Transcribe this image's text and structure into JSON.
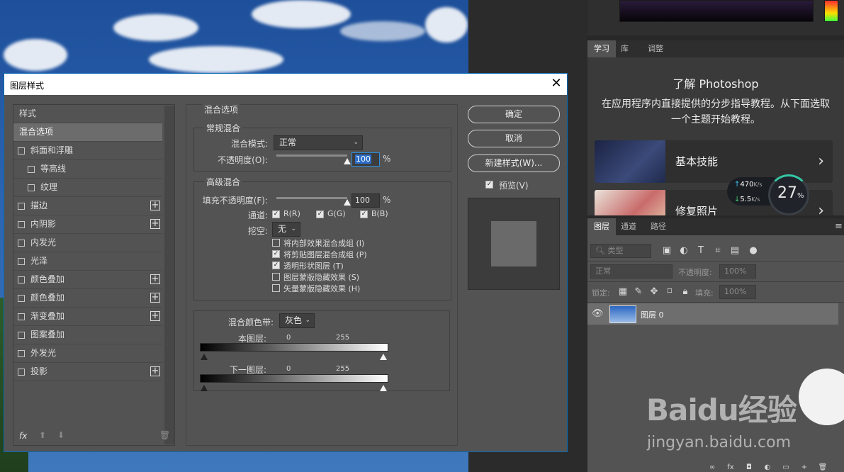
{
  "dialog": {
    "title": "图层样式",
    "close_glyph": "✕",
    "style_list": [
      {
        "label": "样式",
        "checkbox": false,
        "plus": false,
        "indent": 0,
        "selected": false
      },
      {
        "label": "混合选项",
        "checkbox": false,
        "plus": false,
        "indent": 0,
        "selected": true
      },
      {
        "label": "斜面和浮雕",
        "checkbox": true,
        "plus": false,
        "indent": 0,
        "selected": false
      },
      {
        "label": "等高线",
        "checkbox": true,
        "plus": false,
        "indent": 1,
        "selected": false
      },
      {
        "label": "纹理",
        "checkbox": true,
        "plus": false,
        "indent": 1,
        "selected": false
      },
      {
        "label": "描边",
        "checkbox": true,
        "plus": true,
        "indent": 0,
        "selected": false
      },
      {
        "label": "内阴影",
        "checkbox": true,
        "plus": true,
        "indent": 0,
        "selected": false
      },
      {
        "label": "内发光",
        "checkbox": true,
        "plus": false,
        "indent": 0,
        "selected": false
      },
      {
        "label": "光泽",
        "checkbox": true,
        "plus": false,
        "indent": 0,
        "selected": false
      },
      {
        "label": "颜色叠加",
        "checkbox": true,
        "plus": true,
        "indent": 0,
        "selected": false
      },
      {
        "label": "颜色叠加",
        "checkbox": true,
        "plus": true,
        "indent": 0,
        "selected": false
      },
      {
        "label": "渐变叠加",
        "checkbox": true,
        "plus": true,
        "indent": 0,
        "selected": false
      },
      {
        "label": "图案叠加",
        "checkbox": true,
        "plus": false,
        "indent": 0,
        "selected": false
      },
      {
        "label": "外发光",
        "checkbox": true,
        "plus": false,
        "indent": 0,
        "selected": false
      },
      {
        "label": "投影",
        "checkbox": true,
        "plus": true,
        "indent": 0,
        "selected": false
      }
    ],
    "footer_icons": [
      "fx-icon",
      "move-up-icon",
      "move-down-icon",
      "trash-icon"
    ],
    "footer_fx_label": "fx",
    "blend": {
      "section_title": "混合选项",
      "normal_group_title": "常规混合",
      "mode_label": "混合模式:",
      "mode_value": "正常",
      "opacity_label": "不透明度(O):",
      "opacity_value": "100",
      "opacity_percent": 100,
      "percent_sign": "%",
      "advanced_group_title": "高级混合",
      "fill_label": "填充不透明度(F):",
      "fill_value": "100",
      "fill_percent": 100,
      "channels_label": "通道:",
      "channels": [
        {
          "label": "R(R)",
          "checked": true
        },
        {
          "label": "G(G)",
          "checked": true
        },
        {
          "label": "B(B)",
          "checked": true
        }
      ],
      "knockout_label": "挖空:",
      "knockout_value": "无",
      "options": [
        {
          "label": "将内部效果混合成组 (I)",
          "checked": false
        },
        {
          "label": "将剪贴图层混合成组 (P)",
          "checked": true
        },
        {
          "label": "透明形状图层 (T)",
          "checked": true
        },
        {
          "label": "图层蒙版隐藏效果 (S)",
          "checked": false
        },
        {
          "label": "矢量蒙版隐藏效果 (H)",
          "checked": false
        }
      ],
      "band_label": "混合颜色带:",
      "band_value": "灰色",
      "this_layer_label": "本图层:",
      "this_layer_min": "0",
      "this_layer_max": "255",
      "below_layer_label": "下一图层:",
      "below_layer_min": "0",
      "below_layer_max": "255"
    },
    "buttons": {
      "ok": "确定",
      "cancel": "取消",
      "new_style": "新建样式(W)...",
      "preview_label": "预览(V)",
      "preview_checked": true
    }
  },
  "right_panel": {
    "learn_tabs": [
      "学习",
      "库",
      "调整"
    ],
    "learn_title": "了解 Photoshop",
    "learn_desc": "在应用程序内直接提供的分步指导教程。从下面选取一个主题开始教程。",
    "cards": [
      {
        "label": "基本技能",
        "arrow": "›"
      },
      {
        "label": "修复照片",
        "arrow": "›"
      }
    ],
    "layers_tabs": [
      "图层",
      "通道",
      "路径"
    ],
    "filter_label": "类型",
    "blend_mode": "正常",
    "opacity_label": "不透明度:",
    "opacity_value": "100%",
    "lock_label": "锁定:",
    "fill_label": "填充:",
    "fill_value": "100%",
    "layer_name": "图层 0"
  },
  "speed_widget": {
    "up": "470",
    "up_unit": "K/s",
    "down": "5.5",
    "down_unit": "K/s",
    "percent": "27",
    "percent_sign": "%"
  },
  "watermark": {
    "logo": "Baidu经验",
    "url": "jingyan.baidu.com"
  },
  "colors": {
    "dialog_bg": "#535353",
    "accent_focus": "#2d8fe0",
    "selected_item": "#6c6c6c"
  }
}
